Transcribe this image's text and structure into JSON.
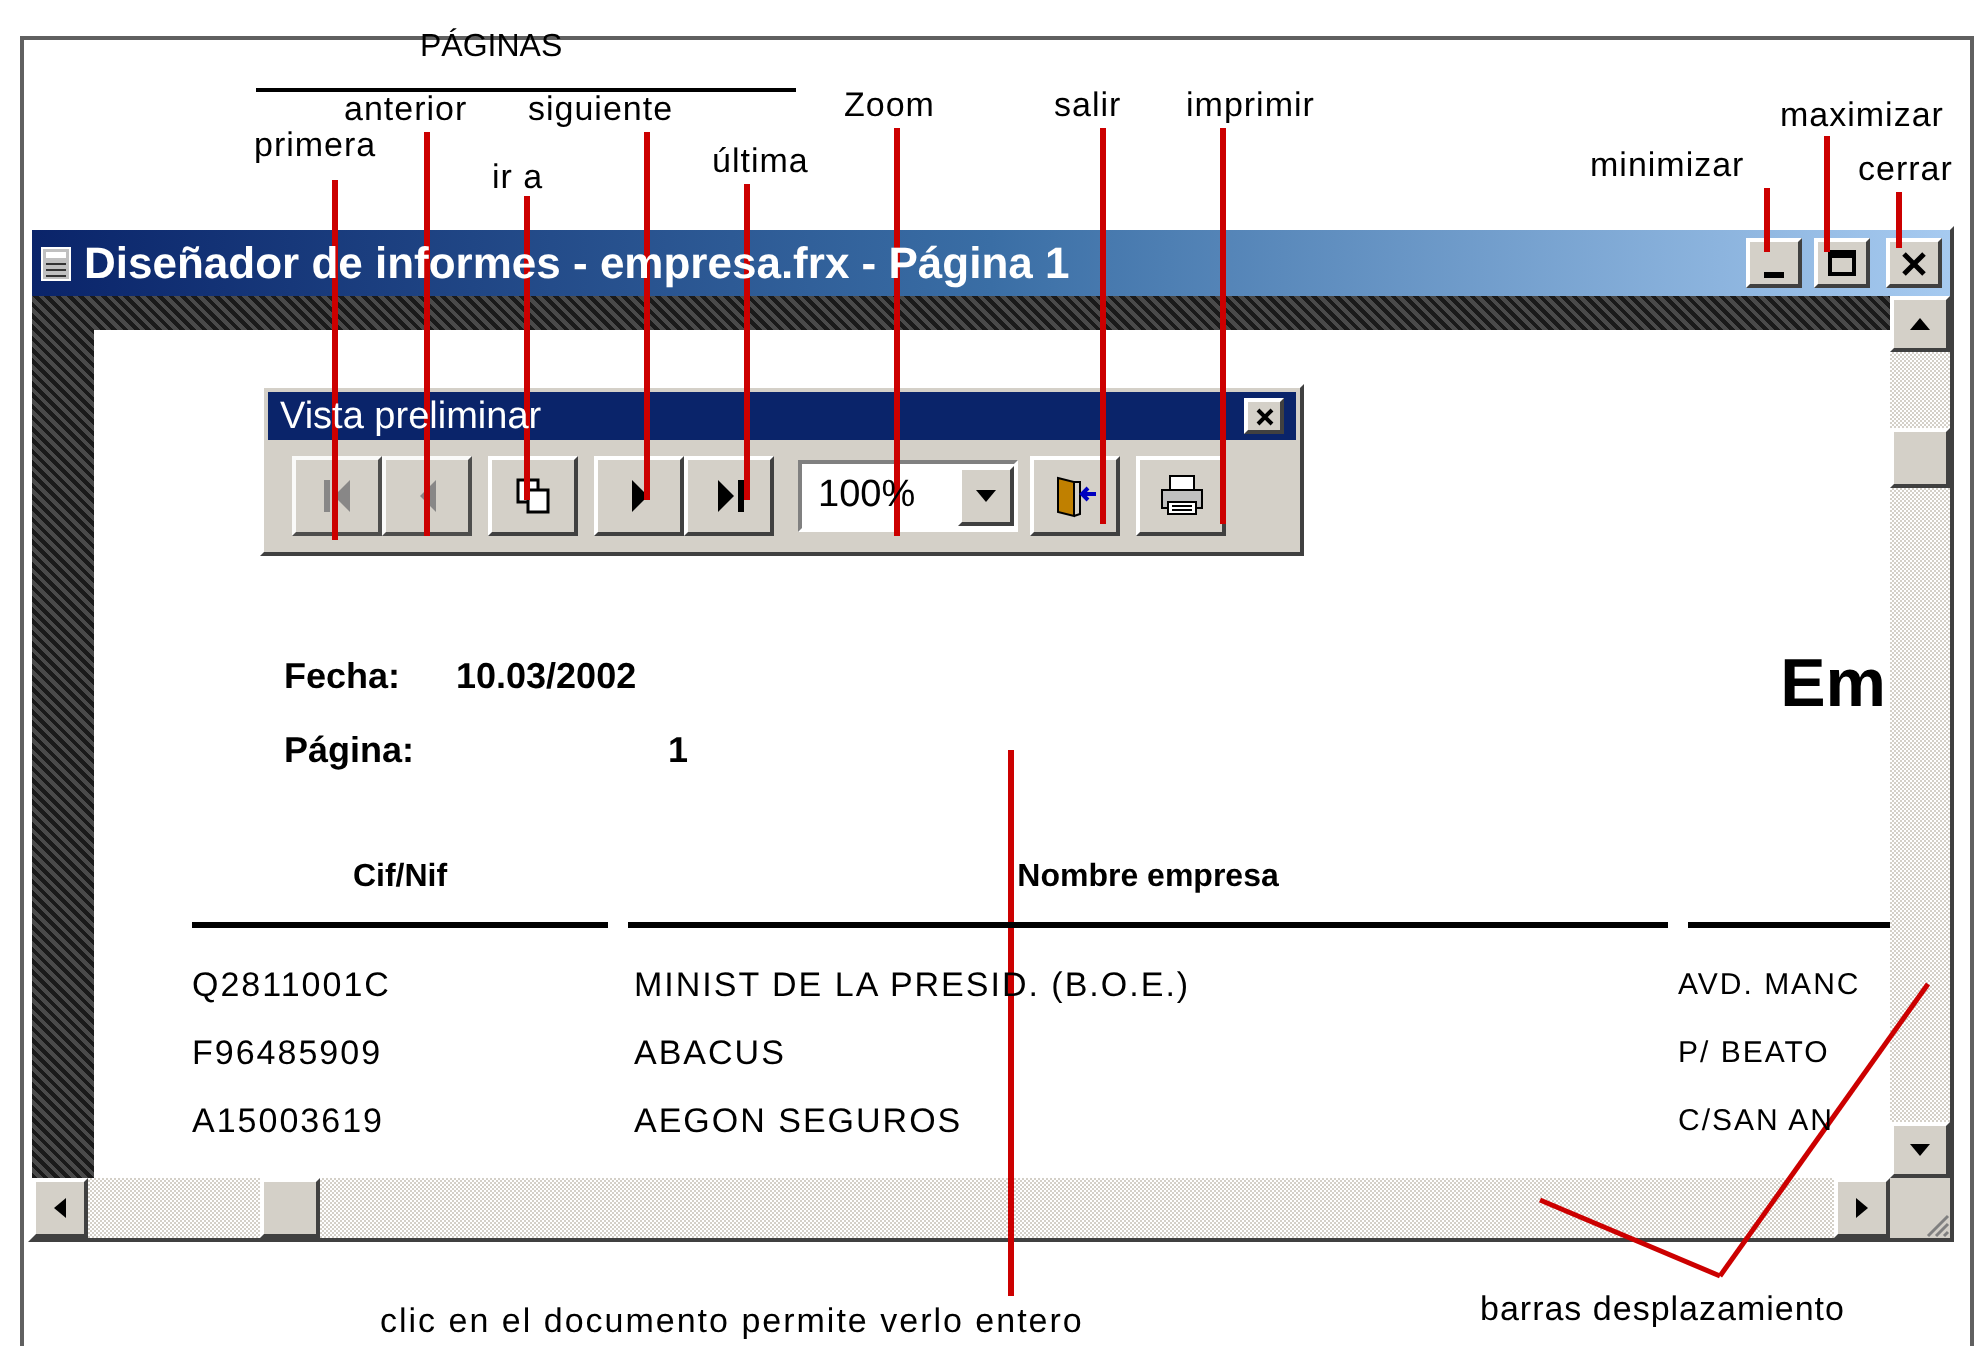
{
  "pages_group": {
    "label": "PÁGINAS"
  },
  "top_labels": [
    {
      "text": "primera"
    },
    {
      "text": "anterior"
    },
    {
      "text": "ir a"
    },
    {
      "text": "siguiente"
    },
    {
      "text": "última"
    },
    {
      "text": "Zoom"
    },
    {
      "text": "salir"
    },
    {
      "text": "imprimir"
    },
    {
      "text": "minimizar"
    },
    {
      "text": "maximizar"
    },
    {
      "text": "cerrar"
    }
  ],
  "window": {
    "title": "Diseñador de informes - empresa.frx - Página 1"
  },
  "toolbar": {
    "title": "Vista preliminar",
    "buttons": [
      {
        "kind": "first",
        "disabled": true
      },
      {
        "kind": "previous",
        "disabled": true
      },
      {
        "kind": "goto",
        "disabled": false
      },
      {
        "kind": "next",
        "disabled": false
      },
      {
        "kind": "last",
        "disabled": false
      },
      {
        "kind": "zoom",
        "value": "100%",
        "disabled": false
      },
      {
        "kind": "exit",
        "disabled": false
      },
      {
        "kind": "print",
        "disabled": false
      }
    ]
  },
  "report": {
    "date_label": "Fecha:",
    "date_value": "10.03/2002",
    "page_label": "Página:",
    "page_value": "1",
    "title": "Em",
    "columns": [
      "Cif/Nif",
      "Nombre empresa"
    ],
    "rows": [
      [
        "Q2811001C",
        "MINIST DE LA PRESID. (B.O.E.)",
        "AVD. MANC"
      ],
      [
        "F96485909",
        "ABACUS",
        "P/ BEATO"
      ],
      [
        "A15003619",
        "AEGON SEGUROS",
        "C/SAN AN"
      ]
    ]
  },
  "bottom_labels": [
    {
      "text": "clic en el documento permite verlo entero"
    },
    {
      "text": "barras desplazamiento"
    }
  ]
}
